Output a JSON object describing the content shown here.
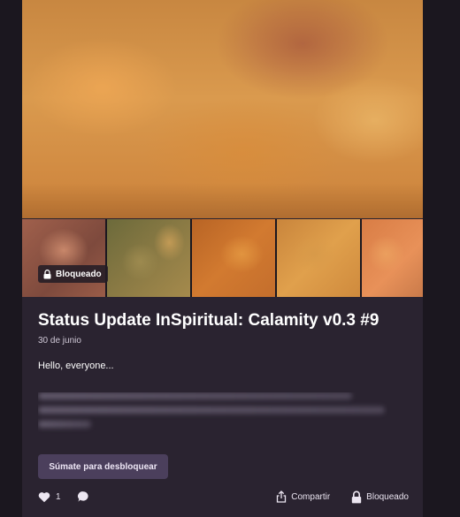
{
  "post": {
    "title": "Status Update InSpiritual: Calamity v0.3 #9",
    "date": "30 de junio",
    "body_intro": "Hello, everyone...",
    "locked_badge": "Bloqueado",
    "unlock_button": "Súmate para desbloquear",
    "like_count": "1"
  },
  "footer": {
    "share_label": "Compartir",
    "locked_label": "Bloqueado"
  },
  "icons": {
    "like": "heart-icon",
    "comment": "comment-icon",
    "share": "share-icon",
    "lock": "lock-icon"
  },
  "colors": {
    "page_background": "#1b171f",
    "card_background": "#2a2330",
    "button_background": "#4b3f5c"
  }
}
